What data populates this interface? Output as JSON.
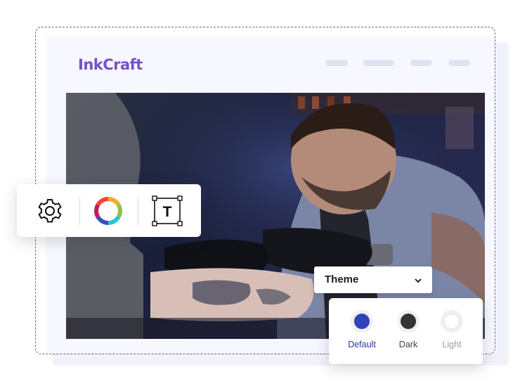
{
  "brand": {
    "name": "InkCraft",
    "color": "#7552c8"
  },
  "nav": {
    "items": [
      "",
      "",
      "",
      ""
    ]
  },
  "toolbar": {
    "icons": [
      "gear-icon",
      "color-wheel-icon",
      "text-tool-icon"
    ],
    "text_tool_glyph": "T"
  },
  "theme": {
    "label": "Theme",
    "options": [
      {
        "name": "Default",
        "color": "#2f44b8",
        "label_color": "#2b3a92"
      },
      {
        "name": "Dark",
        "color": "#333333",
        "label_color": "#444444"
      },
      {
        "name": "Light",
        "color": "#ffffff",
        "label_color": "#9a9aa6"
      }
    ]
  }
}
